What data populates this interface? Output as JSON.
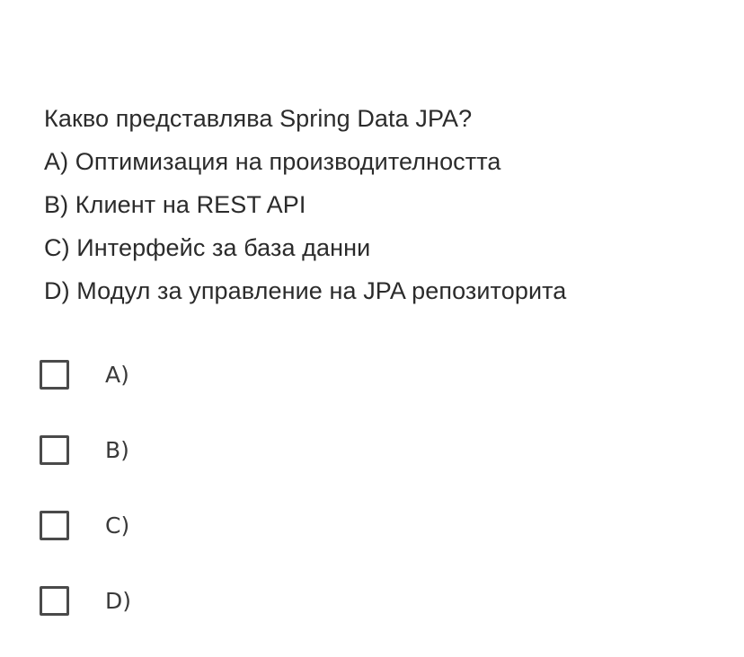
{
  "question": {
    "text": "Какво представлява Spring Data JPA?",
    "options": [
      "A) Оптимизация на производителността",
      "B) Клиент на REST API",
      "C) Интерфейс за база данни",
      "D) Модул за управление на JPA репозиторита"
    ]
  },
  "answers": [
    {
      "label": "A)",
      "checked": false
    },
    {
      "label": "B)",
      "checked": false
    },
    {
      "label": "C)",
      "checked": false
    },
    {
      "label": "D)",
      "checked": false
    }
  ]
}
